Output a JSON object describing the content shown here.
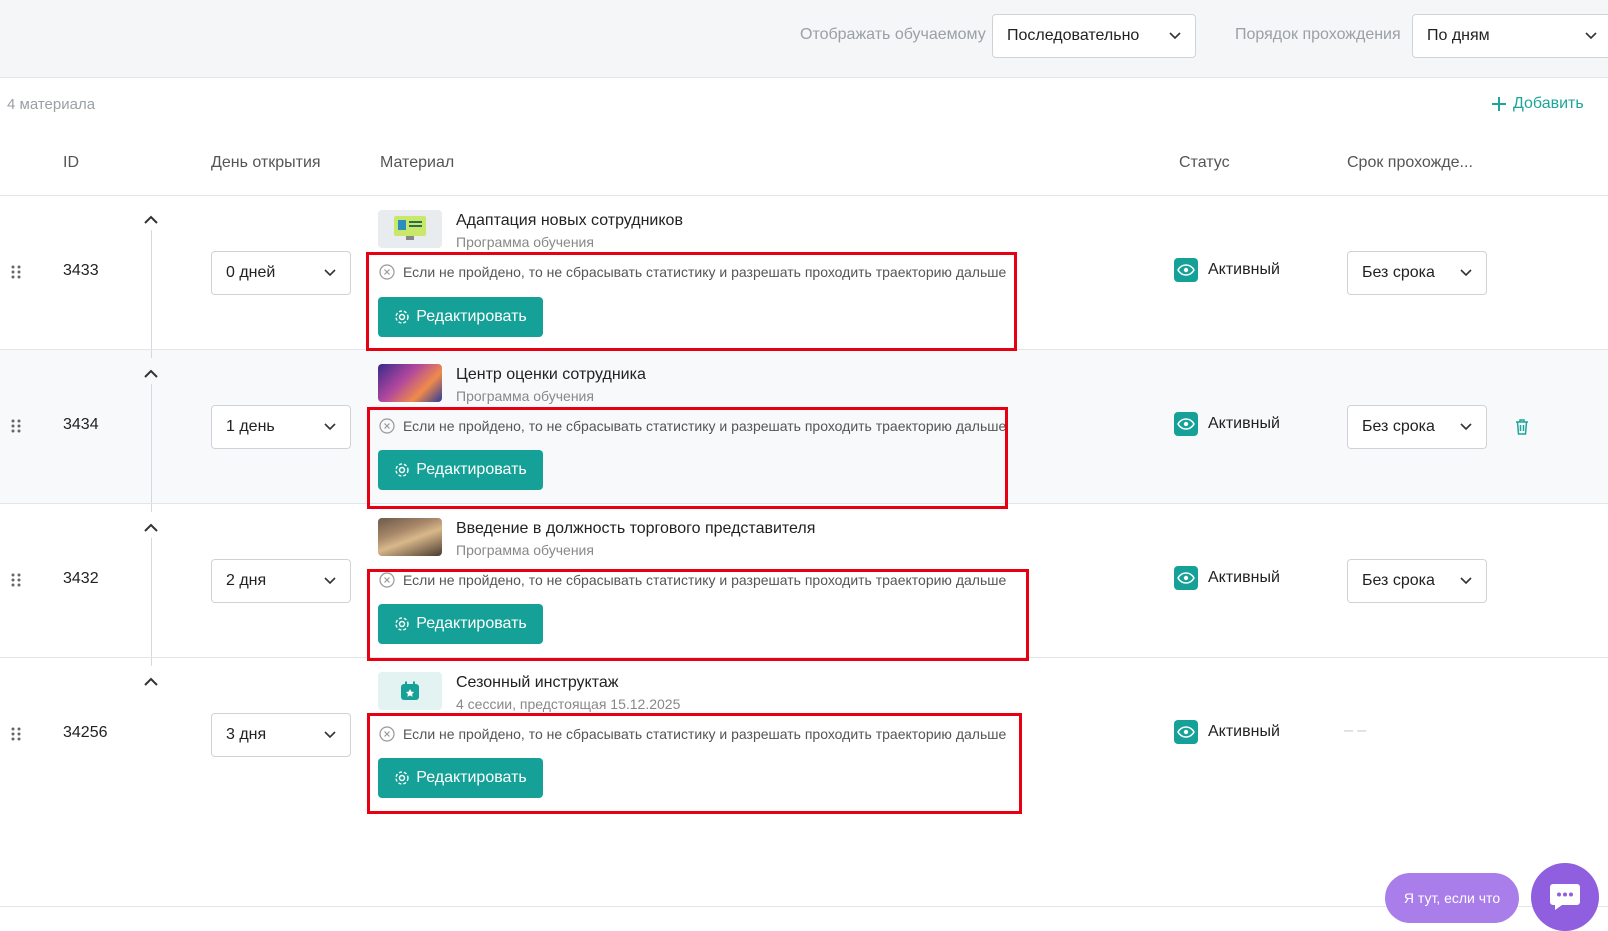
{
  "toolbar": {
    "display_label": "Отображать обучаемому",
    "display_value": "Последовательно",
    "order_label": "Порядок прохождения",
    "order_value": "По дням"
  },
  "list": {
    "count_text": "4 материала",
    "add_label": "Добавить"
  },
  "columns": {
    "id": "ID",
    "open_day": "День открытия",
    "material": "Материал",
    "status": "Статус",
    "deadline": "Срок прохожде..."
  },
  "rows": [
    {
      "id": "3433",
      "open_day": "0 дней",
      "title": "Адаптация новых сотрудников",
      "subtitle": "Программа обучения",
      "note": "Если не пройдено, то не сбрасывать статистику и разрешать проходить траекторию дальше",
      "edit_label": "Редактировать",
      "status": "Активный",
      "deadline": "Без срока"
    },
    {
      "id": "3434",
      "open_day": "1 день",
      "title": "Центр оценки сотрудника",
      "subtitle": "Программа обучения",
      "note": "Если не пройдено, то не сбрасывать статистику и разрешать проходить траекторию дальше",
      "edit_label": "Редактировать",
      "status": "Активный",
      "deadline": "Без срока"
    },
    {
      "id": "3432",
      "open_day": "2 дня",
      "title": "Введение в должность торгового представителя",
      "subtitle": "Программа обучения",
      "note": "Если не пройдено, то не сбрасывать статистику и разрешать проходить траекторию дальше",
      "edit_label": "Редактировать",
      "status": "Активный",
      "deadline": "Без срока"
    },
    {
      "id": "34256",
      "open_day": "3 дня",
      "title": "Сезонный инструктаж",
      "subtitle": "4 сессии, предстоящая 15.12.2025",
      "note": "Если не пройдено, то не сбрасывать статистику и разрешать проходить траекторию дальше",
      "edit_label": "Редактировать",
      "status": "Активный",
      "deadline": "– –"
    }
  ],
  "chat": {
    "pill_text": "Я тут, если что"
  },
  "colors": {
    "accent": "#15a197",
    "highlight": "#e60012",
    "chat": "#8f5fe0"
  }
}
